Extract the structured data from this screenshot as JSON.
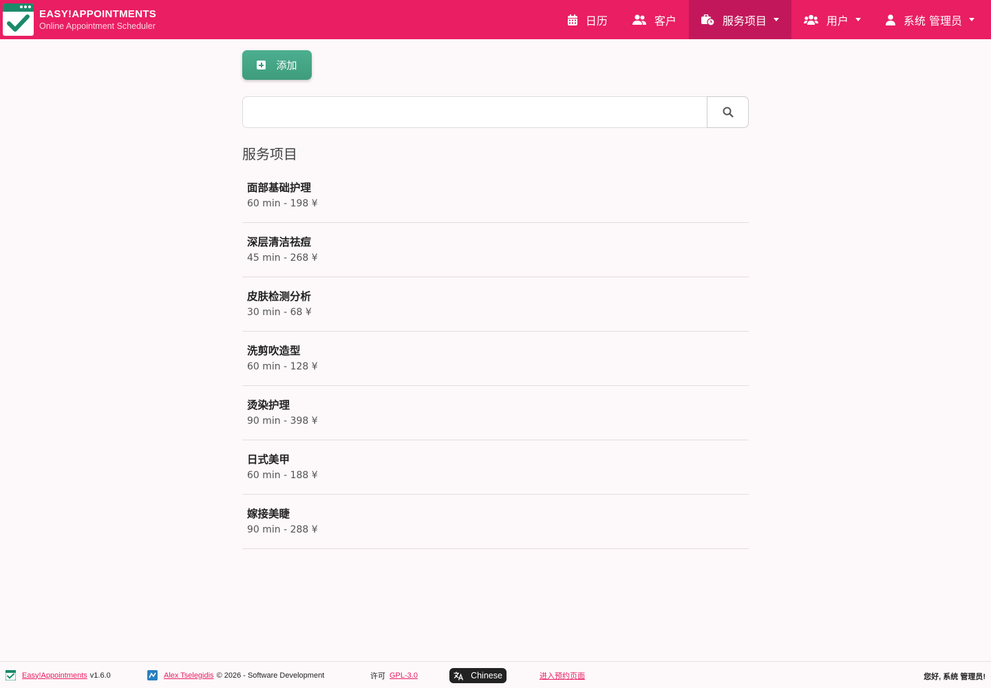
{
  "brand": {
    "title": "EASY!APPOINTMENTS",
    "subtitle": "Online Appointment Scheduler"
  },
  "nav": {
    "calendar": "日历",
    "customers": "客户",
    "services": "服务项目",
    "users": "用户",
    "admin": "系统 管理员"
  },
  "toolbar": {
    "add_label": "添加"
  },
  "search": {
    "value": "",
    "placeholder": ""
  },
  "section_title": "服务项目",
  "services": [
    {
      "name": "面部基础护理",
      "info": "60 min - 198 ¥"
    },
    {
      "name": "深层清洁祛痘",
      "info": "45 min - 268 ¥"
    },
    {
      "name": "皮肤检测分析",
      "info": "30 min - 68 ¥"
    },
    {
      "name": "洗剪吹造型",
      "info": "60 min - 128 ¥"
    },
    {
      "name": "烫染护理",
      "info": "90 min - 398 ¥"
    },
    {
      "name": "日式美甲",
      "info": "60 min - 188 ¥"
    },
    {
      "name": "嫁接美睫",
      "info": "90 min - 288 ¥"
    }
  ],
  "footer": {
    "app_link": "Easy!Appointments",
    "version": "v1.6.0",
    "author_link": "Alex Tselegidis",
    "copyright": "© 2026 - Software Development",
    "license_label": "许可",
    "license_link": "GPL-3.0",
    "language": "Chinese",
    "booking_link": "进入预约页面",
    "greeting": "您好, 系统 管理员!"
  },
  "colors": {
    "primary": "#e91e63",
    "primary_dark": "#c2185b",
    "success": "#3e9c7c",
    "background": "#fdf8f9"
  }
}
